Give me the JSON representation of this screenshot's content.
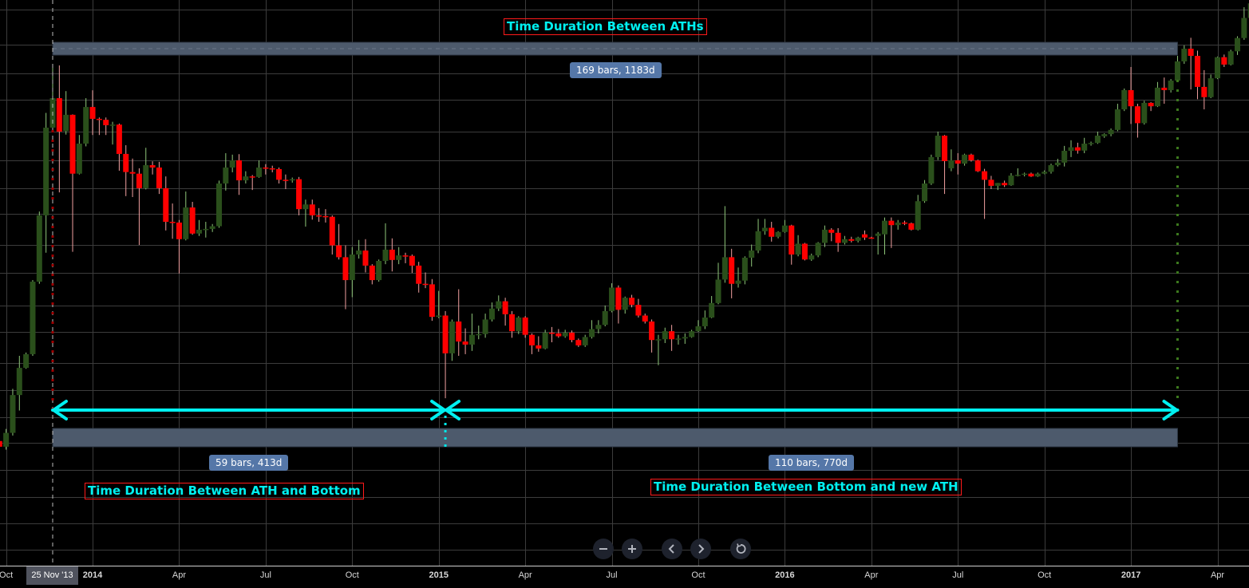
{
  "chart_data": {
    "type": "candlestick",
    "interval": "1W",
    "start_date": "2013-09-30",
    "scale": "log",
    "grid": true,
    "colors": {
      "up_body": "#2a4f1b",
      "up_wick": "#8fc77a",
      "down_body": "#ff0000",
      "down_wick": "#f2a0a0",
      "grid": "#3c3c3c",
      "band": "#4d5a6c",
      "arrow": "#00f0f0",
      "pill": "#5577a8"
    },
    "candles_ohlc": [
      [
        117,
        120,
        112,
        113
      ],
      [
        113,
        126,
        111,
        123
      ],
      [
        123,
        161,
        121,
        155
      ],
      [
        155,
        197,
        141,
        183
      ],
      [
        183,
        201,
        182,
        199
      ],
      [
        199,
        313,
        197,
        310
      ],
      [
        310,
        476,
        306,
        465
      ],
      [
        465,
        870,
        370,
        795
      ],
      [
        795,
        1174,
        773,
        952
      ],
      [
        952,
        1163,
        535,
        776
      ],
      [
        778,
        994,
        762,
        860
      ],
      [
        860,
        862,
        372,
        600
      ],
      [
        600,
        760,
        597,
        721
      ],
      [
        721,
        952,
        709,
        902
      ],
      [
        902,
        999,
        760,
        839
      ],
      [
        839,
        846,
        760,
        834
      ],
      [
        834,
        846,
        760,
        807
      ],
      [
        807,
        824,
        717,
        810
      ],
      [
        810,
        815,
        611,
        677
      ],
      [
        677,
        714,
        523,
        606
      ],
      [
        606,
        658,
        520,
        600
      ],
      [
        600,
        620,
        388,
        549
      ],
      [
        549,
        703,
        545,
        632
      ],
      [
        632,
        647,
        597,
        623
      ],
      [
        623,
        645,
        530,
        549
      ],
      [
        549,
        590,
        424,
        447
      ],
      [
        447,
        500,
        403,
        445
      ],
      [
        445,
        452,
        326,
        402
      ],
      [
        402,
        538,
        399,
        488
      ],
      [
        488,
        505,
        413,
        416
      ],
      [
        416,
        452,
        410,
        426
      ],
      [
        426,
        447,
        406,
        428
      ],
      [
        428,
        441,
        420,
        435
      ],
      [
        435,
        575,
        431,
        565
      ],
      [
        565,
        680,
        541,
        623
      ],
      [
        623,
        674,
        605,
        651
      ],
      [
        651,
        676,
        527,
        576
      ],
      [
        576,
        609,
        565,
        590
      ],
      [
        590,
        595,
        543,
        588
      ],
      [
        588,
        651,
        585,
        623
      ],
      [
        623,
        636,
        597,
        620
      ],
      [
        620,
        630,
        605,
        617
      ],
      [
        617,
        623,
        565,
        578
      ],
      [
        578,
        597,
        546,
        576
      ],
      [
        576,
        586,
        568,
        580
      ],
      [
        580,
        588,
        465,
        483
      ],
      [
        483,
        512,
        434,
        497
      ],
      [
        497,
        512,
        453,
        465
      ],
      [
        465,
        486,
        447,
        463
      ],
      [
        463,
        483,
        445,
        461
      ],
      [
        461,
        465,
        366,
        387
      ],
      [
        387,
        441,
        355,
        360
      ],
      [
        360,
        387,
        262,
        313
      ],
      [
        313,
        383,
        282,
        366
      ],
      [
        366,
        400,
        357,
        375
      ],
      [
        375,
        402,
        328,
        342
      ],
      [
        342,
        345,
        305,
        313
      ],
      [
        313,
        355,
        310,
        352
      ],
      [
        352,
        443,
        345,
        377
      ],
      [
        377,
        404,
        330,
        354
      ],
      [
        354,
        383,
        345,
        364
      ],
      [
        364,
        370,
        347,
        363
      ],
      [
        363,
        366,
        327,
        342
      ],
      [
        342,
        350,
        290,
        306
      ],
      [
        306,
        328,
        298,
        305
      ],
      [
        305,
        315,
        244,
        250
      ],
      [
        250,
        293,
        248,
        252
      ],
      [
        252,
        259,
        152,
        200
      ],
      [
        200,
        246,
        191,
        243
      ],
      [
        243,
        296,
        197,
        215
      ],
      [
        215,
        233,
        199,
        211
      ],
      [
        211,
        255,
        203,
        224
      ],
      [
        224,
        237,
        218,
        225
      ],
      [
        225,
        255,
        220,
        246
      ],
      [
        246,
        273,
        243,
        263
      ],
      [
        263,
        285,
        259,
        275
      ],
      [
        275,
        281,
        237,
        254
      ],
      [
        254,
        259,
        220,
        229
      ],
      [
        229,
        251,
        225,
        249
      ],
      [
        249,
        251,
        220,
        224
      ],
      [
        224,
        226,
        199,
        210
      ],
      [
        210,
        222,
        202,
        206
      ],
      [
        206,
        231,
        205,
        227
      ],
      [
        227,
        235,
        214,
        226
      ],
      [
        226,
        232,
        220,
        222
      ],
      [
        222,
        231,
        220,
        227
      ],
      [
        227,
        230,
        214,
        217
      ],
      [
        217,
        219,
        208,
        210
      ],
      [
        210,
        224,
        208,
        221
      ],
      [
        221,
        245,
        219,
        232
      ],
      [
        232,
        245,
        226,
        238
      ],
      [
        238,
        268,
        236,
        259
      ],
      [
        259,
        307,
        257,
        299
      ],
      [
        299,
        303,
        240,
        261
      ],
      [
        261,
        283,
        255,
        281
      ],
      [
        281,
        286,
        265,
        269
      ],
      [
        269,
        279,
        249,
        252
      ],
      [
        252,
        255,
        240,
        243
      ],
      [
        243,
        246,
        201,
        217
      ],
      [
        217,
        224,
        186,
        218
      ],
      [
        218,
        234,
        213,
        229
      ],
      [
        229,
        238,
        203,
        218
      ],
      [
        218,
        224,
        211,
        219
      ],
      [
        219,
        226,
        212,
        221
      ],
      [
        221,
        231,
        220,
        229
      ],
      [
        229,
        245,
        228,
        236
      ],
      [
        236,
        260,
        232,
        249
      ],
      [
        249,
        284,
        248,
        272
      ],
      [
        272,
        348,
        270,
        314
      ],
      [
        314,
        492,
        308,
        360
      ],
      [
        360,
        379,
        280,
        306
      ],
      [
        306,
        338,
        299,
        312
      ],
      [
        312,
        362,
        305,
        359
      ],
      [
        359,
        389,
        340,
        375
      ],
      [
        375,
        455,
        369,
        422
      ],
      [
        422,
        455,
        413,
        431
      ],
      [
        431,
        447,
        396,
        408
      ],
      [
        408,
        422,
        404,
        420
      ],
      [
        420,
        452,
        418,
        437
      ],
      [
        437,
        439,
        344,
        366
      ],
      [
        366,
        412,
        362,
        391
      ],
      [
        391,
        393,
        353,
        355
      ],
      [
        355,
        368,
        352,
        364
      ],
      [
        364,
        395,
        360,
        393
      ],
      [
        393,
        437,
        383,
        426
      ],
      [
        426,
        430,
        397,
        418
      ],
      [
        418,
        430,
        372,
        393
      ],
      [
        393,
        410,
        389,
        402
      ],
      [
        402,
        408,
        394,
        398
      ],
      [
        398,
        408,
        394,
        406
      ],
      [
        414,
        424,
        400,
        406
      ],
      [
        406,
        408,
        404,
        404
      ],
      [
        410,
        420,
        366,
        416
      ],
      [
        414,
        459,
        366,
        450
      ],
      [
        450,
        459,
        381,
        438
      ],
      [
        438,
        452,
        426,
        445
      ],
      [
        445,
        450,
        438,
        443
      ],
      [
        443,
        445,
        424,
        426
      ],
      [
        426,
        527,
        424,
        507
      ],
      [
        507,
        577,
        502,
        565
      ],
      [
        565,
        674,
        560,
        664
      ],
      [
        664,
        776,
        652,
        757
      ],
      [
        757,
        760,
        530,
        648
      ],
      [
        620,
        696,
        609,
        651
      ],
      [
        651,
        680,
        597,
        638
      ],
      [
        638,
        678,
        630,
        674
      ],
      [
        674,
        678,
        646,
        651
      ],
      [
        651,
        654,
        606,
        609
      ],
      [
        609,
        618,
        455,
        578
      ],
      [
        578,
        592,
        546,
        557
      ],
      [
        557,
        567,
        543,
        567
      ],
      [
        567,
        575,
        553,
        559
      ],
      [
        559,
        602,
        557,
        593
      ],
      [
        593,
        620,
        590,
        596
      ],
      [
        596,
        604,
        590,
        600
      ],
      [
        600,
        604,
        588,
        590
      ],
      [
        590,
        604,
        588,
        600
      ],
      [
        600,
        612,
        598,
        607
      ],
      [
        607,
        638,
        600,
        632
      ],
      [
        632,
        657,
        627,
        642
      ],
      [
        642,
        711,
        627,
        690
      ],
      [
        690,
        736,
        664,
        705
      ],
      [
        705,
        725,
        678,
        691
      ],
      [
        691,
        747,
        680,
        721
      ],
      [
        721,
        730,
        712,
        724
      ],
      [
        724,
        776,
        720,
        757
      ],
      [
        754,
        768,
        747,
        764
      ],
      [
        764,
        791,
        754,
        784
      ],
      [
        784,
        920,
        778,
        889
      ],
      [
        889,
        1010,
        880,
        1000
      ],
      [
        1000,
        1152,
        813,
        906
      ],
      [
        906,
        920,
        748,
        817
      ],
      [
        817,
        937,
        810,
        925
      ],
      [
        925,
        929,
        880,
        906
      ],
      [
        906,
        1051,
        902,
        1015
      ],
      [
        1015,
        1080,
        920,
        1000
      ],
      [
        1000,
        1070,
        985,
        1060
      ],
      [
        1060,
        1233,
        1050,
        1192
      ],
      [
        1192,
        1315,
        1174,
        1288
      ],
      [
        1288,
        1377,
        1004,
        1233
      ],
      [
        1233,
        1273,
        946,
        1020
      ],
      [
        1020,
        1130,
        889,
        958
      ],
      [
        958,
        1100,
        952,
        1075
      ],
      [
        1075,
        1228,
        1070,
        1223
      ],
      [
        1223,
        1243,
        1152,
        1169
      ],
      [
        1169,
        1280,
        1163,
        1268
      ],
      [
        1268,
        1390,
        1240,
        1375
      ],
      [
        1375,
        1660,
        1360,
        1555
      ],
      [
        1555,
        1790,
        1540,
        1700
      ]
    ],
    "x_ticks": [
      {
        "label": "Oct",
        "date": "2013-10-07",
        "major": false
      },
      {
        "label": "2014",
        "date": "2014-01-06",
        "major": true
      },
      {
        "label": "Apr",
        "date": "2014-04-07",
        "major": false
      },
      {
        "label": "Jul",
        "date": "2014-07-07",
        "major": false
      },
      {
        "label": "Oct",
        "date": "2014-10-06",
        "major": false
      },
      {
        "label": "2015",
        "date": "2015-01-05",
        "major": true
      },
      {
        "label": "Apr",
        "date": "2015-04-06",
        "major": false
      },
      {
        "label": "Jul",
        "date": "2015-07-06",
        "major": false
      },
      {
        "label": "Oct",
        "date": "2015-10-05",
        "major": false
      },
      {
        "label": "2016",
        "date": "2016-01-04",
        "major": true
      },
      {
        "label": "Apr",
        "date": "2016-04-04",
        "major": false
      },
      {
        "label": "Jul",
        "date": "2016-07-04",
        "major": false
      },
      {
        "label": "Oct",
        "date": "2016-10-03",
        "major": false
      },
      {
        "label": "2017",
        "date": "2017-01-02",
        "major": true
      },
      {
        "label": "Apr",
        "date": "2017-04-03",
        "major": false
      }
    ],
    "crosshair_label": "25 Nov '13",
    "annotations": {
      "ath_to_ath_title": "Time Duration Between ATHs",
      "ath_to_ath_range": "169 bars, 1183d",
      "ath_to_bottom_title": "Time Duration Between ATH and Bottom",
      "ath_to_bottom_range": "59 bars, 413d",
      "bottom_to_ath_title": "Time Duration Between Bottom and new ATH",
      "bottom_to_ath_range": "110 bars, 770d",
      "ath_bar": 8,
      "bottom_bar": 67,
      "new_ath_bar": 177
    }
  },
  "navigation": {
    "zoom_out": "minus-icon",
    "zoom_in": "plus-icon",
    "scroll_left": "chevron-left-icon",
    "scroll_right": "chevron-right-icon",
    "reset": "reset-icon"
  }
}
